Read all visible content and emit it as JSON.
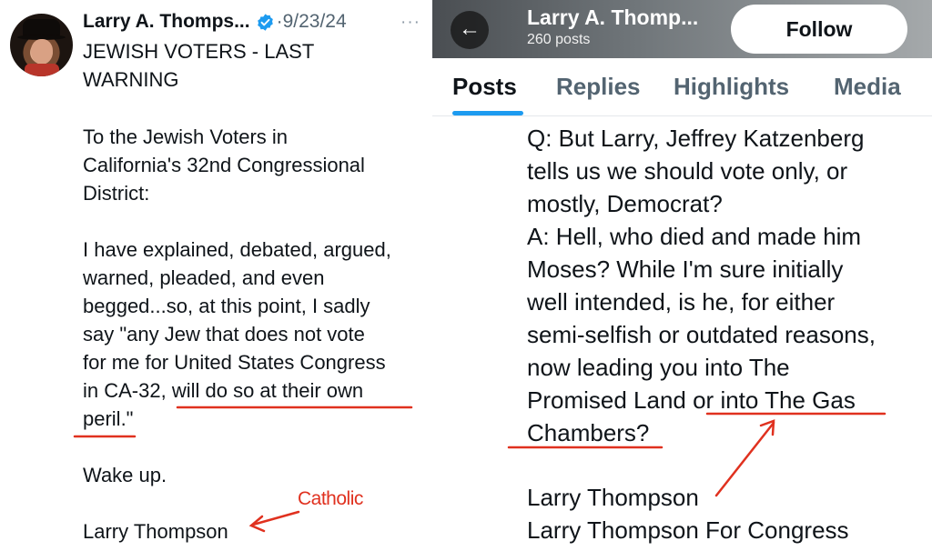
{
  "left_post": {
    "author_name": "Larry A. Thomps...",
    "separator": "·",
    "date": "9/23/24",
    "more_label": "···",
    "lines": [
      "JEWISH VOTERS - LAST",
      "WARNING",
      "To the Jewish Voters in",
      "California's 32nd Congressional",
      "District:",
      "I have explained, debated, argued,",
      "warned, pleaded, and even",
      "begged...so, at this point, I sadly",
      "say \"any Jew that does not vote",
      "for me for United States Congress",
      "in CA-32, will do so at their own",
      "peril.\"",
      "Wake up.",
      "Larry Thompson"
    ]
  },
  "right_profile": {
    "back_icon": "arrow-left-icon",
    "author_name": "Larry A. Thomp...",
    "post_count": "260 posts",
    "follow_label": "Follow",
    "tabs": [
      {
        "label": "Posts",
        "active": true
      },
      {
        "label": "Replies",
        "active": false
      },
      {
        "label": "Highlights",
        "active": false
      },
      {
        "label": "Media",
        "active": false
      }
    ],
    "lines": [
      "Q:  But Larry, Jeffrey Katzenberg",
      "tells us we should vote only, or",
      "mostly, Democrat?",
      "A:  Hell, who died and made him",
      "Moses?  While I'm sure initially",
      "well intended, is he, for either",
      "semi-selfish or outdated reasons,",
      "now leading you into The",
      "Promised Land or into The Gas",
      "Chambers?",
      "Larry Thompson",
      "Larry Thompson For Congress"
    ]
  },
  "annotations": {
    "label": "Catholic",
    "color": "#e0311f"
  },
  "colors": {
    "verified_badge": "#1d9bf0",
    "tab_indicator": "#1d9bf0",
    "secondary_text": "#536471"
  }
}
